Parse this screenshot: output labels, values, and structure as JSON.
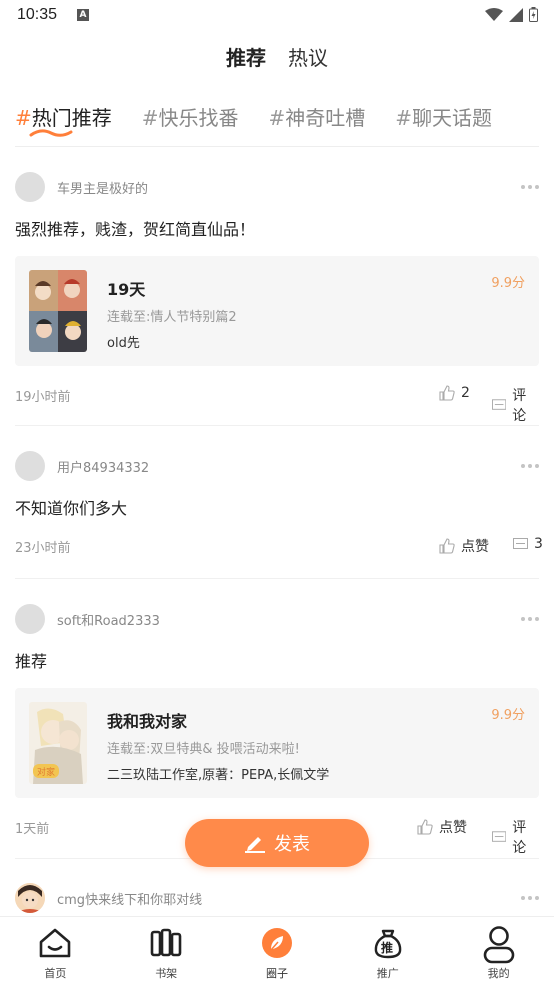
{
  "status_bar": {
    "time": "10:35",
    "notification_icon": "A"
  },
  "top_tabs": [
    {
      "label": "推荐",
      "active": true
    },
    {
      "label": "热议",
      "active": false
    }
  ],
  "topics": [
    {
      "hash": "#",
      "label": "热门推荐",
      "active": true
    },
    {
      "hash": "#",
      "label": "快乐找番",
      "active": false
    },
    {
      "hash": "#",
      "label": "神奇吐槽",
      "active": false
    },
    {
      "hash": "#",
      "label": "聊天话题",
      "active": false
    }
  ],
  "posts": [
    {
      "username": "车男主是极好的",
      "text": "强烈推荐，贱渣，贺红简直仙品！",
      "book": {
        "title": "19天",
        "update": "连载至:情人节特别篇2",
        "author": "old先",
        "score": "9.9分"
      },
      "time": "19小时前",
      "like_label": "2",
      "comment_label": "评论"
    },
    {
      "username": "用户84934332",
      "text": "不知道你们多大",
      "time": "23小时前",
      "like_label": "点赞",
      "comment_label": "3"
    },
    {
      "username": "soft和Road2333",
      "text": "推荐",
      "book": {
        "title": "我和我对家",
        "update": "连载至:双旦特典& 投喂活动来啦!",
        "author": "二三玖陆工作室,原著：PEPA,长佩文学",
        "score": "9.9分"
      },
      "time": "1天前",
      "like_label": "点赞",
      "comment_label": "评论"
    },
    {
      "username": "cmg快来线下和你耶对线"
    }
  ],
  "publish_button": {
    "label": "发表"
  },
  "bottom_nav": [
    {
      "label": "首页",
      "icon": "home-icon"
    },
    {
      "label": "书架",
      "icon": "bookshelf-icon"
    },
    {
      "label": "圈子",
      "icon": "circle-icon",
      "active": true
    },
    {
      "label": "推广",
      "icon": "promote-icon"
    },
    {
      "label": "我的",
      "icon": "profile-icon"
    }
  ],
  "colors": {
    "accent": "#ff8a4a",
    "score": "#f0a060",
    "muted": "#999999"
  }
}
